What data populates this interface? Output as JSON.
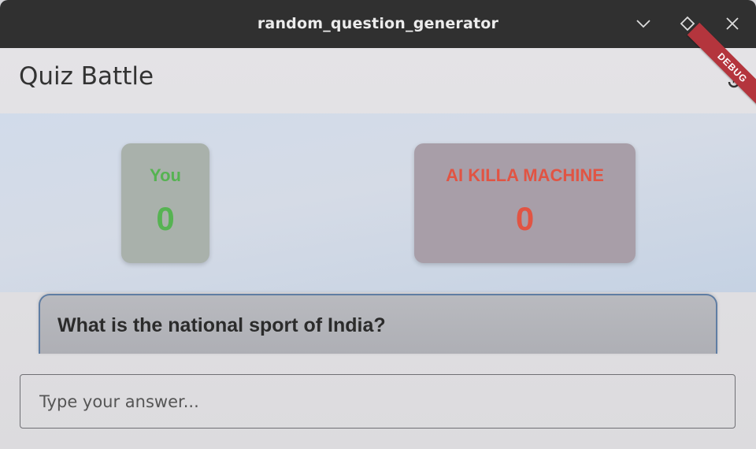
{
  "window": {
    "title": "random_question_generator",
    "buttons": [
      "minimize",
      "maximize",
      "close"
    ]
  },
  "appbar": {
    "title": "Quiz Battle",
    "debug_banner": "DEBUG"
  },
  "scoreboard": {
    "player": {
      "name": "You",
      "score": "0",
      "color": "#56b352"
    },
    "ai": {
      "name": "AI KILLA MACHINE",
      "score": "0",
      "color": "#e15443"
    }
  },
  "question": {
    "text": "What is the national sport of India?"
  },
  "answer": {
    "placeholder": "Type your answer...",
    "value": ""
  }
}
